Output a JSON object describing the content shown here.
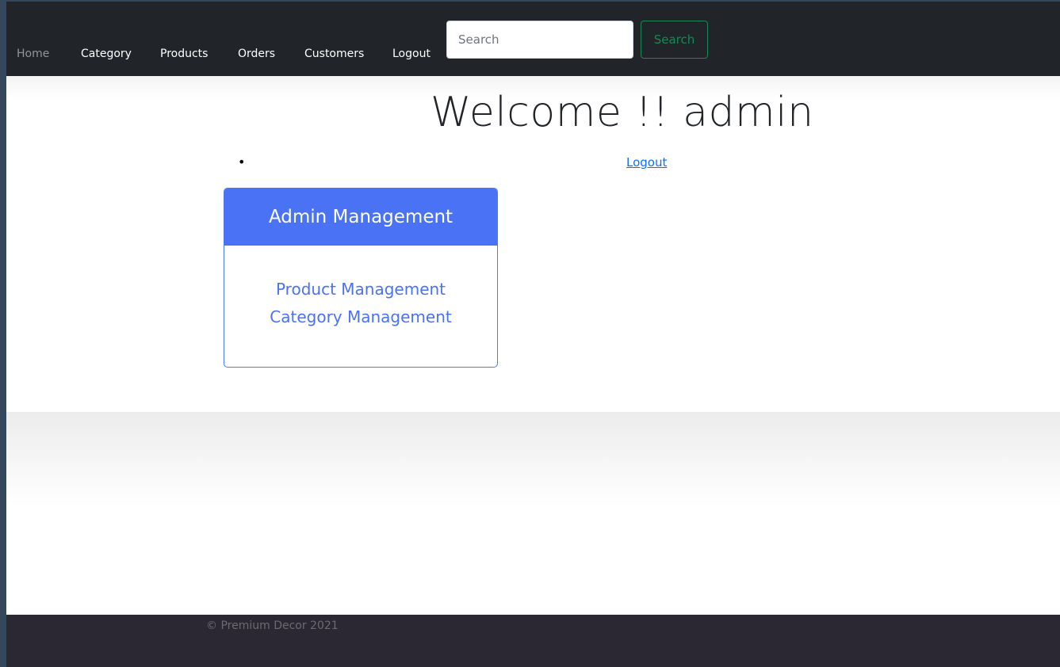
{
  "navbar": {
    "links": {
      "home": "Home",
      "category": "Category",
      "products": "Products",
      "orders": "Orders",
      "customers": "Customers",
      "logout": "Logout"
    },
    "search": {
      "placeholder": "Search",
      "value": "",
      "button_label": "Search"
    }
  },
  "main": {
    "welcome": "Welcome !! admin",
    "bullet": "•",
    "logout_link": "Logout",
    "card": {
      "title": "Admin Management",
      "links": [
        "Product Management",
        "Category Management"
      ]
    }
  },
  "footer": {
    "copyright": "© Premium Decor 2021"
  },
  "colors": {
    "navbar_bg": "#212529",
    "accent_blue": "#4a72f5",
    "search_green": "#198754",
    "footer_bg": "#2b2733"
  }
}
